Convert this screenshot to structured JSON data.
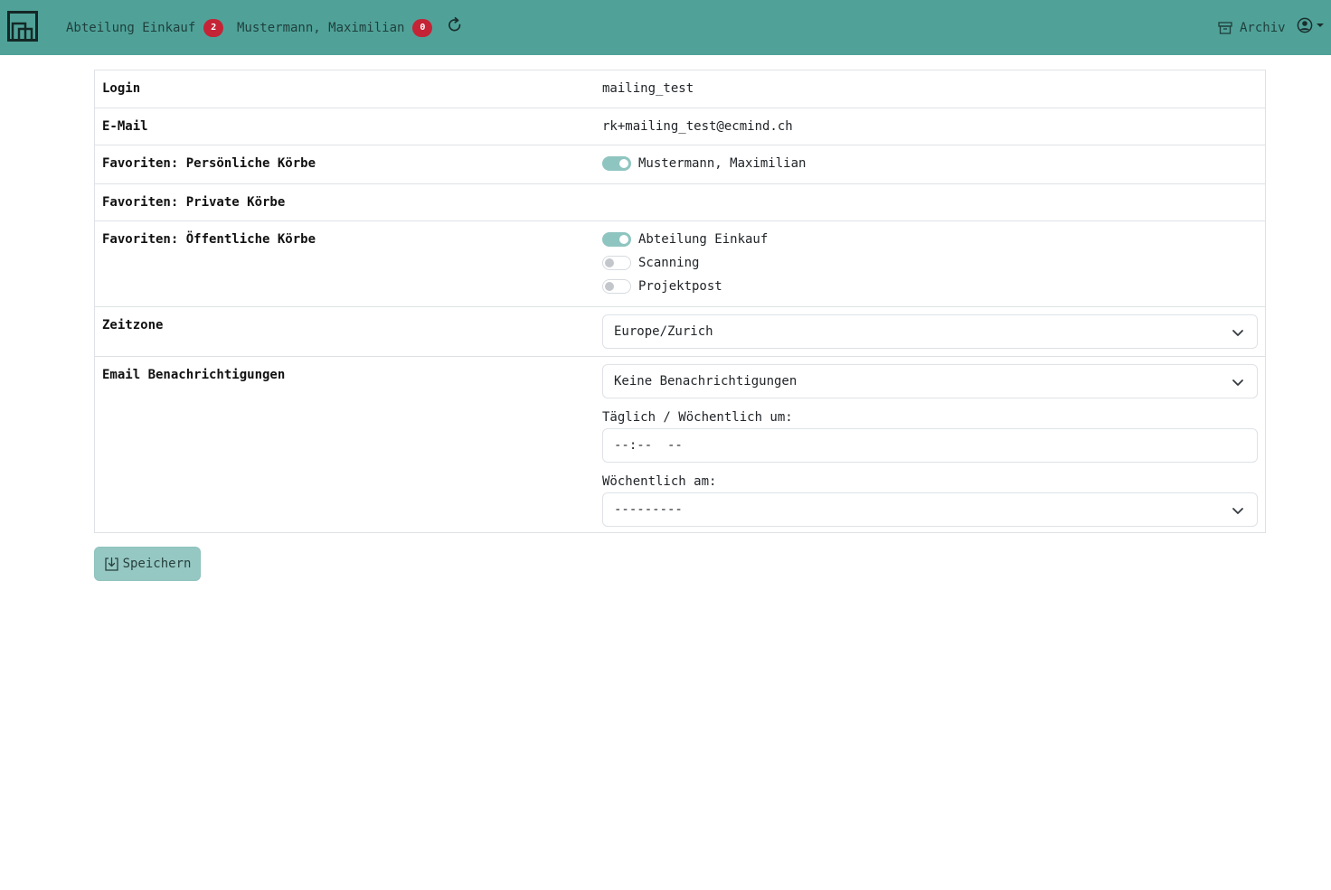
{
  "nav": {
    "logo": "app-logo-icon",
    "mailbox_department": {
      "label": "Abteilung Einkauf",
      "count": "2"
    },
    "mailbox_personal": {
      "label": "Mustermann, Maximilian",
      "count": "0"
    },
    "refresh_icon": "refresh-icon",
    "archive": {
      "label": "Archiv",
      "icon": "archive-icon"
    },
    "user_icon": "user-circle-icon",
    "color_bg": "#50a299",
    "color_badge": "#c42436"
  },
  "settings": {
    "login": {
      "label": "Login",
      "value": "mailing_test"
    },
    "email": {
      "label": "E-Mail",
      "value": "rk+mailing_test@ecmind.ch"
    },
    "personal_baskets": {
      "label": "Favoriten: Persönliche Körbe",
      "items": [
        {
          "label": "Mustermann, Maximilian",
          "checked": true
        }
      ]
    },
    "private_baskets": {
      "label": "Favoriten: Private Körbe"
    },
    "public_baskets": {
      "label": "Favoriten: Öffentliche Körbe",
      "items": [
        {
          "label": "Abteilung Einkauf",
          "checked": true
        },
        {
          "label": "Scanning",
          "checked": false
        },
        {
          "label": "Projektpost",
          "checked": false
        }
      ]
    },
    "timezone": {
      "label": "Zeitzone",
      "selected": "Europe/Zurich"
    },
    "notifications": {
      "label": "Email Benachrichtigungen",
      "selected": "Keine Benachrichtigungen",
      "time_label": "Täglich / Wöchentlich um:",
      "time_value": "--:--  --",
      "weekday_label": "Wöchentlich am:",
      "weekday_selected": "---------"
    }
  },
  "save_button": {
    "label": "Speichern",
    "icon": "save-download-icon"
  }
}
